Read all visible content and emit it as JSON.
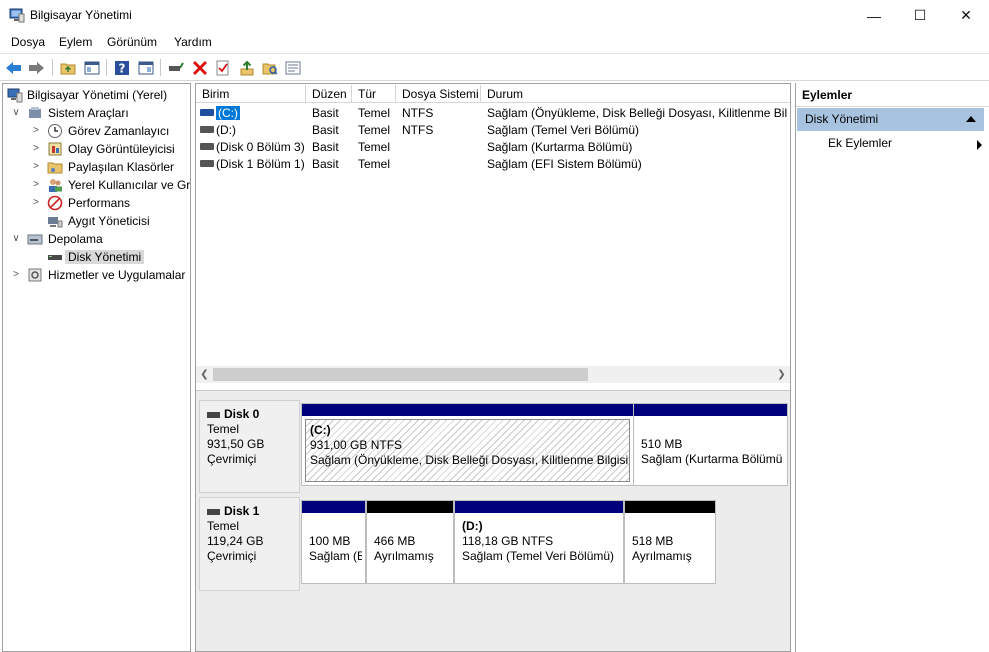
{
  "window": {
    "title": "Bilgisayar Yönetimi",
    "min_glyph": "—",
    "max_glyph": "☐",
    "close_glyph": "✕"
  },
  "menu": [
    "Dosya",
    "Eylem",
    "Görünüm",
    "Yardım"
  ],
  "toolbar": [
    "back-icon",
    "forward-icon",
    "up-folder-icon",
    "show-hide-console-tree-icon",
    "help-icon",
    "properties-pane-icon",
    "connect-drive-icon",
    "delete-icon",
    "checklist-icon",
    "up-arrow-icon",
    "search-folder-icon",
    "list-view-icon"
  ],
  "tree": [
    {
      "label": "Bilgisayar Yönetimi (Yerel)",
      "level": 0,
      "expander": "",
      "icon": "computer-management-icon"
    },
    {
      "label": "Sistem Araçları",
      "level": 1,
      "expander": "∨",
      "icon": "system-tools-icon"
    },
    {
      "label": "Görev Zamanlayıcı",
      "level": 2,
      "expander": ">",
      "icon": "task-scheduler-icon"
    },
    {
      "label": "Olay Görüntüleyicisi",
      "level": 2,
      "expander": ">",
      "icon": "event-viewer-icon"
    },
    {
      "label": "Paylaşılan Klasörler",
      "level": 2,
      "expander": ">",
      "icon": "shared-folders-icon"
    },
    {
      "label": "Yerel Kullanıcılar ve Gru",
      "level": 2,
      "expander": ">",
      "icon": "local-users-icon"
    },
    {
      "label": "Performans",
      "level": 2,
      "expander": ">",
      "icon": "performance-icon"
    },
    {
      "label": "Aygıt Yöneticisi",
      "level": 2,
      "expander": "",
      "icon": "device-manager-icon"
    },
    {
      "label": "Depolama",
      "level": 1,
      "expander": "∨",
      "icon": "storage-icon"
    },
    {
      "label": "Disk Yönetimi",
      "level": 2,
      "expander": "",
      "icon": "disk-management-icon",
      "selected": true
    },
    {
      "label": "Hizmetler ve Uygulamalar",
      "level": 1,
      "expander": ">",
      "icon": "services-icon"
    }
  ],
  "volume_table": {
    "headers": [
      "Birim",
      "Düzen",
      "Tür",
      "Dosya Sistemi",
      "Durum"
    ],
    "rows": [
      {
        "volume": "(C:)",
        "layout": "Basit",
        "type": "Temel",
        "fs": "NTFS",
        "status": "Sağlam (Önyükleme, Disk Belleği Dosyası, Kilitlenme Bilgis",
        "selected": true,
        "icon": "blue"
      },
      {
        "volume": "(D:)",
        "layout": "Basit",
        "type": "Temel",
        "fs": "NTFS",
        "status": "Sağlam (Temel Veri Bölümü)",
        "icon": "gray"
      },
      {
        "volume": "(Disk 0 Bölüm 3)",
        "layout": "Basit",
        "type": "Temel",
        "fs": "",
        "status": "Sağlam (Kurtarma Bölümü)",
        "icon": "gray"
      },
      {
        "volume": "(Disk 1 Bölüm 1)",
        "layout": "Basit",
        "type": "Temel",
        "fs": "",
        "status": "Sağlam (EFI Sistem Bölümü)",
        "icon": "gray"
      }
    ]
  },
  "disks": [
    {
      "name": "Disk 0",
      "type": "Temel",
      "size": "931,50 GB",
      "state": "Çevrimiçi",
      "partitions": [
        {
          "label": "(C:)",
          "size": "931,00 GB NTFS",
          "status": "Sağlam (Önyükleme, Disk Belleği Dosyası, Kilitlenme Bilgisi, T",
          "bar": "primary",
          "hatched": true
        },
        {
          "label": "",
          "size": "510 MB",
          "status": "Sağlam (Kurtarma Bölümü",
          "bar": "primary",
          "hatched": false
        }
      ]
    },
    {
      "name": "Disk 1",
      "type": "Temel",
      "size": "119,24 GB",
      "state": "Çevrimiçi",
      "partitions": [
        {
          "label": "",
          "size": "100 MB",
          "status": "Sağlam (E",
          "bar": "primary",
          "hatched": false
        },
        {
          "label": "",
          "size": "466 MB",
          "status": "Ayrılmamış",
          "bar": "unalloc",
          "hatched": false
        },
        {
          "label": "(D:)",
          "size": "118,18 GB NTFS",
          "status": "Sağlam (Temel Veri Bölümü)",
          "bar": "primary",
          "hatched": false
        },
        {
          "label": "",
          "size": "518 MB",
          "status": "Ayrılmamış",
          "bar": "unalloc",
          "hatched": false
        }
      ]
    }
  ],
  "actions": {
    "header": "Eylemler",
    "section": "Disk Yönetimi",
    "item": "Ek Eylemler"
  },
  "colors": {
    "selection": "#0078d7",
    "primary_partition_bar": "#00007b",
    "unallocated_bar": "#000000",
    "actions_section_bg": "#a8c3e0"
  }
}
